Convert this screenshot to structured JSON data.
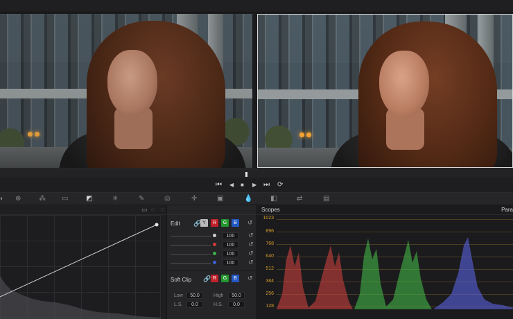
{
  "transport": {
    "first_frame": "⏮",
    "prev_frame": "◀",
    "stop": "■",
    "play": "▶",
    "last_frame": "⏭",
    "loop": "⟳"
  },
  "edit_panel": {
    "title": "Edit",
    "channels": {
      "y": "Y",
      "r": "R",
      "g": "G",
      "b": "B"
    },
    "rows": [
      {
        "color": "#cfcfcf",
        "value": "100"
      },
      {
        "color": "#d23a3a",
        "value": "100"
      },
      {
        "color": "#3ab24a",
        "value": "100"
      },
      {
        "color": "#3a64d2",
        "value": "100"
      }
    ]
  },
  "soft_clip": {
    "title": "Soft Clip",
    "low_label": "Low",
    "low": "50.0",
    "high_label": "High",
    "high": "50.0",
    "ls_label": "L.S.",
    "ls": "0.0",
    "hs_label": "H.S.",
    "hs": "0.0"
  },
  "scopes": {
    "title": "Scopes",
    "mode": "Para",
    "scale": [
      "1023",
      "896",
      "768",
      "640",
      "512",
      "384",
      "256",
      "128"
    ]
  },
  "colors": {
    "red_trace": "#d9443f",
    "green_trace": "#45c24a",
    "blue_trace": "#5a63e0",
    "scale_text": "#d49a2a"
  }
}
